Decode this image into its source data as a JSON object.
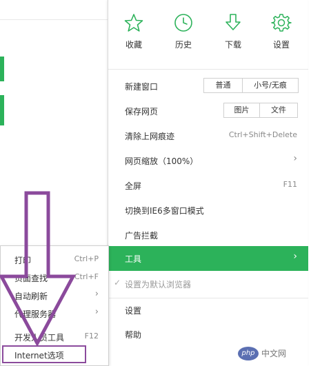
{
  "top_icons": [
    {
      "label": "收藏",
      "icon": "star-icon"
    },
    {
      "label": "历史",
      "icon": "clock-icon"
    },
    {
      "label": "下载",
      "icon": "download-icon"
    },
    {
      "label": "设置",
      "icon": "gear-icon"
    }
  ],
  "menu": {
    "new_window": {
      "label": "新建窗口",
      "options": [
        "普通",
        "小号/无痕"
      ]
    },
    "save_page": {
      "label": "保存网页",
      "options": [
        "图片",
        "文件"
      ]
    },
    "clear_history": {
      "label": "清除上网痕迹",
      "shortcut": "Ctrl+Shift+Delete"
    },
    "zoom": {
      "label": "网页缩放（100%）"
    },
    "fullscreen": {
      "label": "全屏",
      "shortcut": "F11"
    },
    "ie6_mode": {
      "label": "切换到IE6多窗口模式"
    },
    "ad_block": {
      "label": "广告拦截"
    },
    "tools": {
      "label": "工具"
    },
    "set_default": {
      "label": "设置为默认浏览器"
    },
    "settings": {
      "label": "设置"
    },
    "help": {
      "label": "帮助"
    }
  },
  "submenu": {
    "print": {
      "label": "打印",
      "shortcut": "Ctrl+P"
    },
    "find": {
      "label": "页面查找",
      "shortcut": "Ctrl+F"
    },
    "auto_refresh": {
      "label": "自动刷新"
    },
    "proxy": {
      "label": "代理服务器"
    },
    "devtools": {
      "label": "开发人员工具",
      "shortcut": "F12"
    },
    "internet_options": {
      "label": "Internet选项"
    }
  },
  "colors": {
    "accent": "#2cb25a",
    "annotation": "#8b4a9c"
  },
  "watermark": {
    "badge": "php",
    "text": "中文网"
  }
}
